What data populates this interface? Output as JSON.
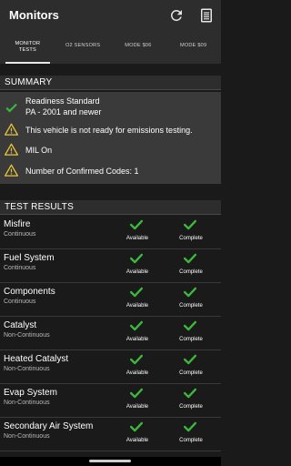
{
  "app": {
    "title": "Monitors",
    "accent_green": "#3db83d",
    "warning_yellow": "#e8c53a",
    "icons": [
      "refresh-icon",
      "manual-icon"
    ]
  },
  "tabs": [
    {
      "label": "MONITOR\nTESTS",
      "active": true
    },
    {
      "label": "O2 SENSORS",
      "active": false
    },
    {
      "label": "MODE $06",
      "active": false
    },
    {
      "label": "MODE $09",
      "active": false
    }
  ],
  "summary": {
    "heading": "SUMMARY",
    "items": [
      {
        "icon": "check-icon",
        "text": "Readiness Standard\nPA - 2001 and newer"
      },
      {
        "icon": "warning-icon",
        "text": "This vehicle is not ready for emissions testing."
      },
      {
        "icon": "warning-icon",
        "text": "MIL On"
      },
      {
        "icon": "warning-icon",
        "text": "Number of Confirmed Codes: 1"
      }
    ]
  },
  "results": {
    "heading": "TEST RESULTS",
    "rows": [
      {
        "name": "Misfire",
        "type": "Continuous",
        "available": "Available",
        "complete": "Complete"
      },
      {
        "name": "Fuel System",
        "type": "Continuous",
        "available": "Available",
        "complete": "Complete"
      },
      {
        "name": "Components",
        "type": "Continuous",
        "available": "Available",
        "complete": "Complete"
      },
      {
        "name": "Catalyst",
        "type": "Non-Continuous",
        "available": "Available",
        "complete": "Complete"
      },
      {
        "name": "Heated Catalyst",
        "type": "Non-Continuous",
        "available": "Available",
        "complete": "Complete"
      },
      {
        "name": "Evap System",
        "type": "Non-Continuous",
        "available": "Available",
        "complete": "Complete"
      },
      {
        "name": "Secondary Air System",
        "type": "Non-Continuous",
        "available": "Available",
        "complete": "Complete"
      }
    ]
  }
}
